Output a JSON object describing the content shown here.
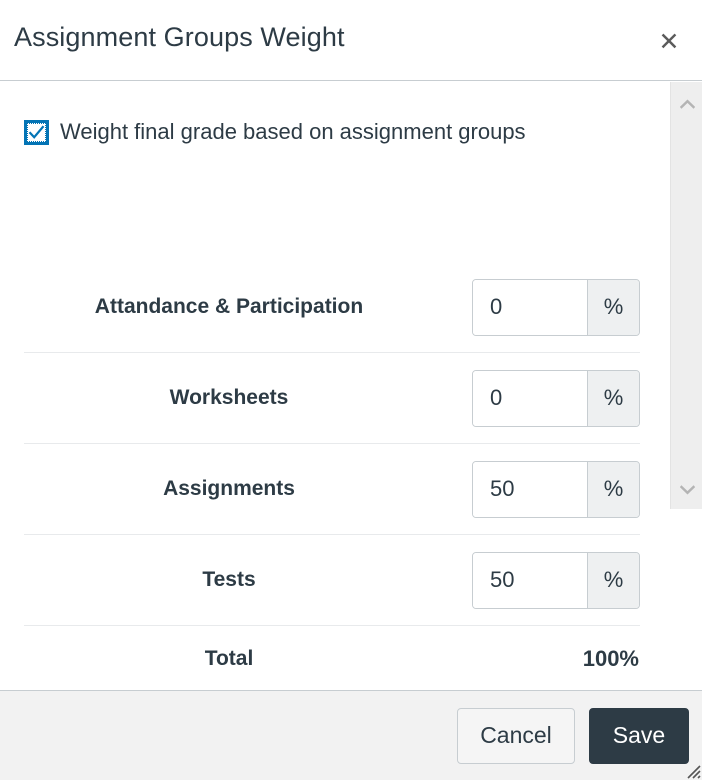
{
  "dialog": {
    "title": "Assignment Groups Weight",
    "close_icon": "close-icon",
    "close_label": "✕"
  },
  "weight_toggle": {
    "label": "Weight final grade based on assignment groups",
    "checked": true,
    "checkbox_icon": "checkmark-icon"
  },
  "groups": [
    {
      "name": "Attandance & Participation",
      "value": "0",
      "unit": "%"
    },
    {
      "name": "Worksheets",
      "value": "0",
      "unit": "%"
    },
    {
      "name": "Assignments",
      "value": "50",
      "unit": "%"
    },
    {
      "name": "Tests",
      "value": "50",
      "unit": "%"
    }
  ],
  "total": {
    "label": "Total",
    "value": "100%"
  },
  "scrollbar": {
    "up_icon": "chevron-up-icon",
    "down_icon": "chevron-down-icon"
  },
  "footer": {
    "cancel_label": "Cancel",
    "save_label": "Save"
  },
  "colors": {
    "accent": "#0374b5",
    "text": "#2d3b45",
    "border": "#c7cdd1",
    "footer_bg": "#f2f2f2",
    "addon_bg": "#eef0f1",
    "save_bg": "#2d3b45"
  }
}
